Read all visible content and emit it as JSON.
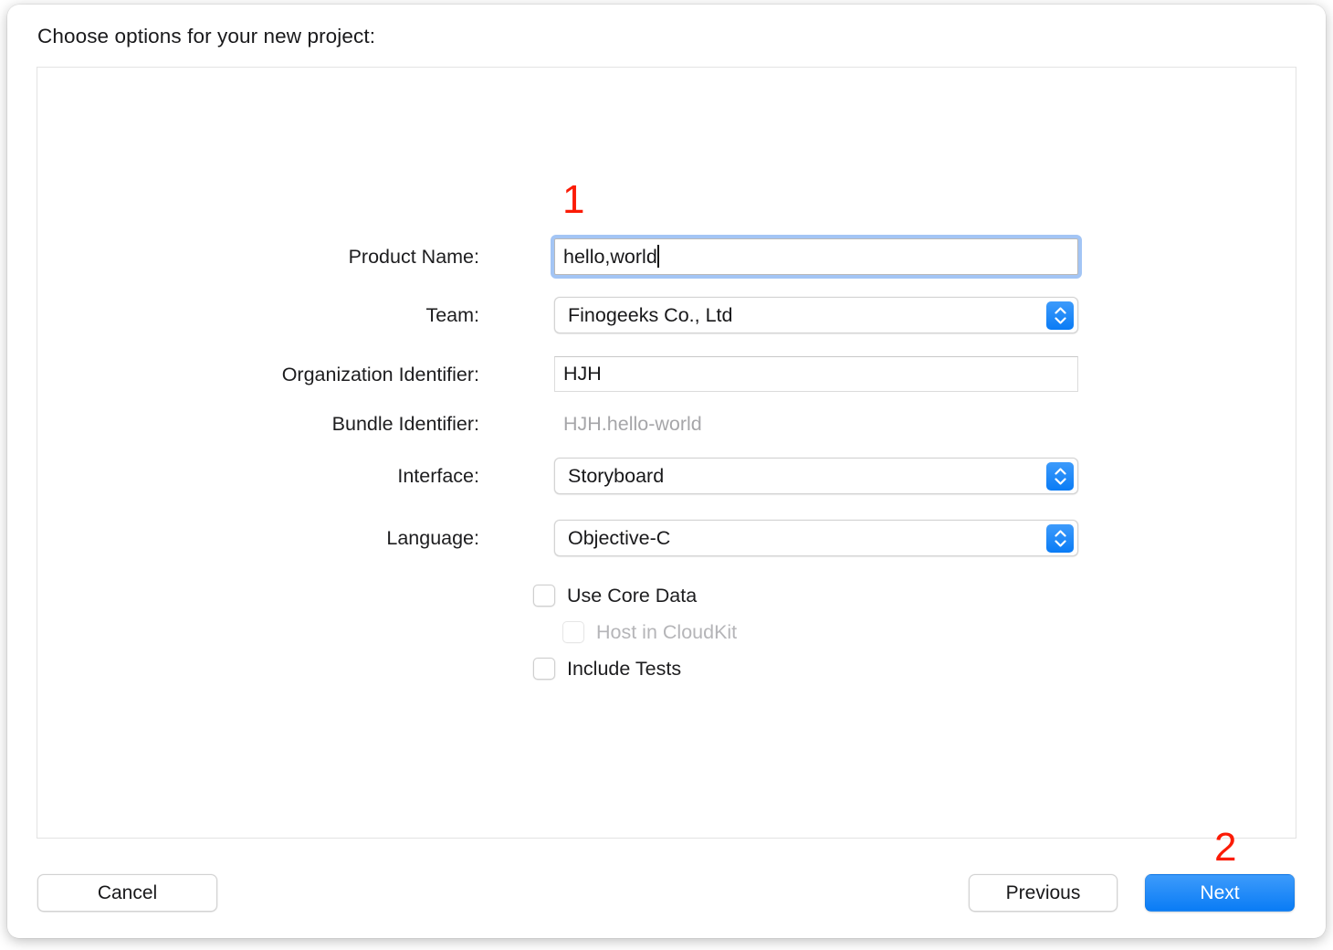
{
  "dialog": {
    "title": "Choose options for your new project:"
  },
  "form": {
    "fields": [
      {
        "label": "Product Name:",
        "value": "hello,world",
        "type": "textfield",
        "focused": true
      },
      {
        "label": "Team:",
        "value": "Finogeeks Co., Ltd",
        "type": "popup",
        "focused": false
      },
      {
        "label": "Organization Identifier:",
        "value": "HJH",
        "type": "textfield",
        "focused": false
      },
      {
        "label": "Bundle Identifier:",
        "value": "HJH.hello-world",
        "type": "static",
        "focused": false
      },
      {
        "label": "Interface:",
        "value": "Storyboard",
        "type": "popup",
        "focused": false
      },
      {
        "label": "Language:",
        "value": "Objective-C",
        "type": "popup",
        "focused": false
      }
    ],
    "checkboxes": [
      {
        "label": "Use Core Data",
        "checked": false,
        "disabled": false
      },
      {
        "label": "Host in CloudKit",
        "checked": false,
        "disabled": true
      },
      {
        "label": "Include Tests",
        "checked": false,
        "disabled": false
      }
    ]
  },
  "footer": {
    "cancel_label": "Cancel",
    "previous_label": "Previous",
    "next_label": "Next"
  },
  "annotations": [
    {
      "text": "1"
    },
    {
      "text": "2"
    }
  ],
  "colors": {
    "accent_blue": "#0a7cf5",
    "focus_ring": "#a3c5f5",
    "annotation_red": "#fb1b06",
    "panel_border": "#e3e3e3",
    "disabled_text": "#a6a6a9"
  }
}
